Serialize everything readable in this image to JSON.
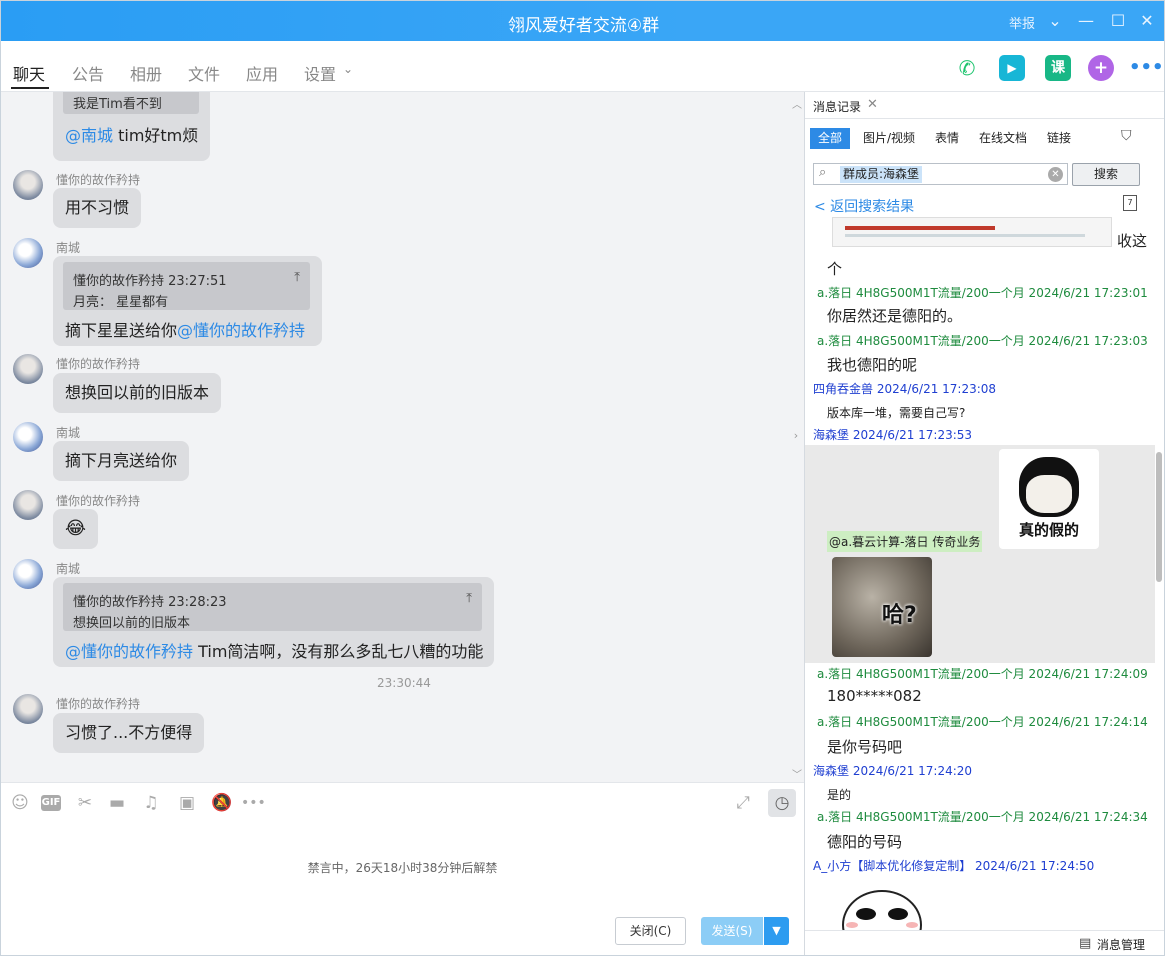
{
  "window": {
    "title": "翎风爱好者交流④群",
    "report": "举报"
  },
  "tabs": [
    {
      "label": "聊天"
    },
    {
      "label": "公告"
    },
    {
      "label": "相册"
    },
    {
      "label": "文件"
    },
    {
      "label": "应用"
    },
    {
      "label": "设置"
    }
  ],
  "header_buttons": {
    "class_label": "课"
  },
  "chat": {
    "top_partial": {
      "quote_line2": "我是Tim看不到",
      "mention": "@南城",
      "text": " tim好tm烦"
    },
    "messages": [
      {
        "sender": "懂你的故作矜持",
        "text": "用不习惯"
      },
      {
        "sender": "南城",
        "quote_title": "懂你的故作矜持    23:27:51",
        "quote_body": "月亮：  星星都有",
        "text": "摘下星星送给你",
        "mention": "@懂你的故作矜持"
      },
      {
        "sender": "懂你的故作矜持",
        "text": "想换回以前的旧版本"
      },
      {
        "sender": "南城",
        "text": "摘下月亮送给你"
      },
      {
        "sender": "懂你的故作矜持",
        "text": "😂"
      },
      {
        "sender": "南城",
        "quote_title": "懂你的故作矜持    23:28:23",
        "quote_body": "想换回以前的旧版本",
        "mention": "@懂你的故作矜持",
        "text": " Tim简洁啊，没有那么多乱七八糟的功能"
      },
      {
        "sender": "懂你的故作矜持",
        "text": "习惯了...不方便得"
      }
    ],
    "time_separator": "23:30:44"
  },
  "input": {
    "gif_label": "GIF",
    "ban_notice": "禁言中，26天18小时38分钟后解禁",
    "close_label": "关闭(C)",
    "send_label": "发送(S)"
  },
  "panel": {
    "tab_label": "消息记录",
    "filters": [
      "全部",
      "图片/视频",
      "表情",
      "在线文档",
      "链接"
    ],
    "search_value": "群成员:海森堡",
    "search_button": "搜索",
    "back_label": "< 返回搜索结果",
    "first_text": "收这",
    "first_text2": "个",
    "records": [
      {
        "meta": "a.落日 4H8G500M1T流量/200一个月 2024/6/21 17:23:01",
        "text": "你居然还是德阳的。"
      },
      {
        "meta": "a.落日 4H8G500M1T流量/200一个月 2024/6/21 17:23:03",
        "text": "我也德阳的呢"
      },
      {
        "meta": "四角吞金兽 2024/6/21 17:23:08",
        "text": "版本库一堆，需要自己写?"
      },
      {
        "meta": "海森堡 2024/6/21 17:23:53",
        "text": ""
      },
      {
        "meta": "a.落日 4H8G500M1T流量/200一个月 2024/6/21 17:24:09",
        "text": "180*****082"
      },
      {
        "meta": "a.落日 4H8G500M1T流量/200一个月 2024/6/21 17:24:14",
        "text": "是你号码吧"
      },
      {
        "meta": "海森堡 2024/6/21 17:24:20",
        "text": "是的"
      },
      {
        "meta": "a.落日 4H8G500M1T流量/200一个月 2024/6/21 17:24:34",
        "text": "德阳的号码"
      },
      {
        "meta": "A_小方【脚本优化修复定制】 2024/6/21 17:24:50",
        "text": ""
      }
    ],
    "mention_tag": "@a.暮云计算-落日 传奇业务",
    "sticker1_text": "真的假的",
    "sticker2_text": "哈?",
    "footer_label": "消息管理"
  }
}
